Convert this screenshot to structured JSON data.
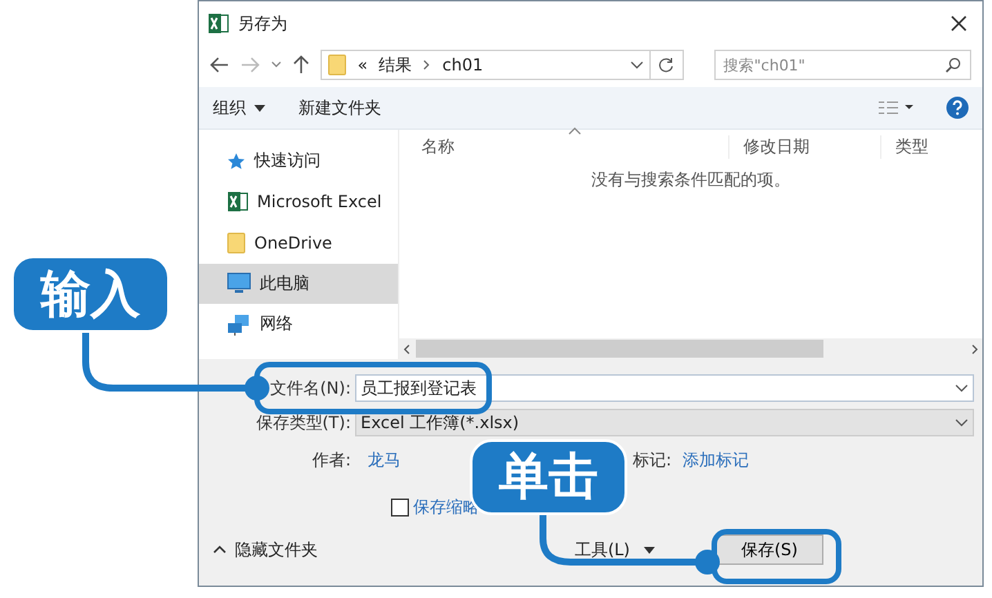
{
  "window": {
    "title": "另存为"
  },
  "address": {
    "overflow": "«",
    "path": [
      "结果",
      "ch01"
    ]
  },
  "search": {
    "placeholder": "搜索\"ch01\""
  },
  "toolbar": {
    "organize": "组织",
    "new_folder": "新建文件夹"
  },
  "columns": [
    "名称",
    "修改日期",
    "类型"
  ],
  "empty_message": "没有与搜索条件匹配的项。",
  "sidebar": {
    "items": [
      {
        "label": "快速访问",
        "kind": "star",
        "selected": false
      },
      {
        "label": "Microsoft Excel",
        "kind": "excel",
        "selected": false
      },
      {
        "label": "OneDrive",
        "kind": "folder",
        "selected": false
      },
      {
        "label": "此电脑",
        "kind": "pc",
        "selected": true
      },
      {
        "label": "网络",
        "kind": "network",
        "selected": false
      }
    ]
  },
  "form": {
    "filename_label": "文件名(N):",
    "filename": "员工报到登记表",
    "type_label": "保存类型(T):",
    "type": "Excel 工作簿(*.xlsx)",
    "author_label": "作者:",
    "author": "龙马",
    "tags_label": "标记:",
    "tags": "添加标记",
    "thumbnail_label": "保存缩略",
    "thumbnail_checked": false
  },
  "footer": {
    "hide_folders": "隐藏文件夹",
    "tools": "工具(L)",
    "save": "保存(S)"
  },
  "callouts": [
    {
      "text": "输入"
    },
    {
      "text": "单击"
    }
  ]
}
